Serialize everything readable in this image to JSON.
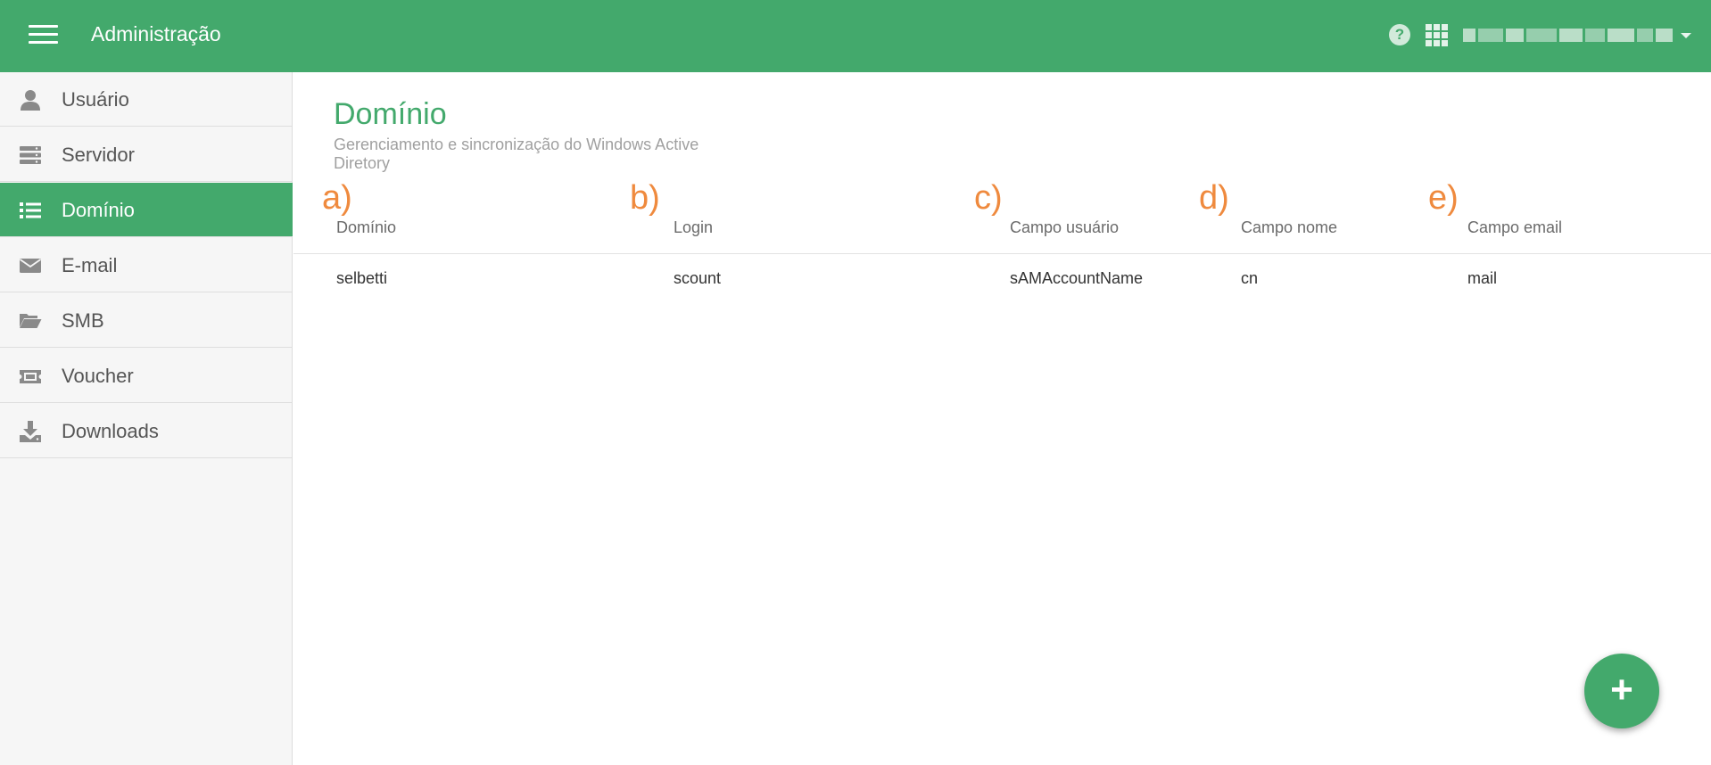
{
  "header": {
    "app_title": "Administração",
    "menu_icon": "hamburger-menu-icon",
    "help_icon": "help-circle-icon",
    "help_glyph": "?",
    "apps_icon": "apps-grid-icon",
    "user_caret_icon": "caret-down-icon"
  },
  "sidebar": {
    "items": [
      {
        "label": "Usuário",
        "icon": "user-icon"
      },
      {
        "label": "Servidor",
        "icon": "server-icon"
      },
      {
        "label": "Domínio",
        "icon": "list-icon"
      },
      {
        "label": "E-mail",
        "icon": "envelope-icon"
      },
      {
        "label": "SMB",
        "icon": "folder-open-icon"
      },
      {
        "label": "Voucher",
        "icon": "ticket-icon"
      },
      {
        "label": "Downloads",
        "icon": "download-icon"
      }
    ],
    "active_label": "Domínio"
  },
  "page": {
    "title": "Domínio",
    "subtitle": "Gerenciamento e sincronização do Windows Active Diretory"
  },
  "annotations": [
    "a)",
    "b)",
    "c)",
    "d)",
    "e)"
  ],
  "table": {
    "columns": [
      "Domínio",
      "Login",
      "Campo usuário",
      "Campo nome",
      "Campo email"
    ],
    "rows": [
      [
        "selbetti",
        "scount",
        "sAMAccountName",
        "cn",
        "mail"
      ]
    ]
  },
  "fab": {
    "label": "+",
    "icon": "plus-icon"
  },
  "colors": {
    "brand": "#43a96c",
    "annotation": "#ef8a3e",
    "sidebar_bg": "#f6f6f6",
    "subtitle": "#a0a0a0"
  }
}
